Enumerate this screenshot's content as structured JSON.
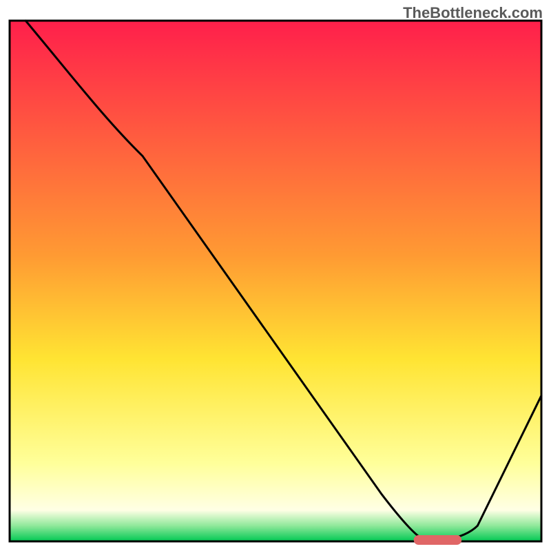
{
  "watermark": "TheBottleneck.com",
  "chart_data": {
    "type": "line",
    "title": "",
    "xlabel": "",
    "ylabel": "",
    "x_range": [
      0,
      100
    ],
    "y_range": [
      0,
      100
    ],
    "series": [
      {
        "name": "curve",
        "x": [
          3,
          25,
          78,
          82,
          88,
          100
        ],
        "y": [
          100,
          74,
          0,
          0,
          3,
          28
        ]
      }
    ],
    "optimal_marker": {
      "x_start": 76,
      "x_end": 85,
      "y": 0
    },
    "gradient_stops": [
      {
        "offset": 0,
        "color": "#ff1f4b"
      },
      {
        "offset": 45,
        "color": "#ff9a33"
      },
      {
        "offset": 65,
        "color": "#ffe433"
      },
      {
        "offset": 85,
        "color": "#ffff9a"
      },
      {
        "offset": 94,
        "color": "#ffffe5"
      },
      {
        "offset": 97,
        "color": "#8fe89a"
      },
      {
        "offset": 100,
        "color": "#00c853"
      }
    ],
    "border_color": "#000000",
    "curve_color": "#000000",
    "marker_color": "#e06666"
  }
}
